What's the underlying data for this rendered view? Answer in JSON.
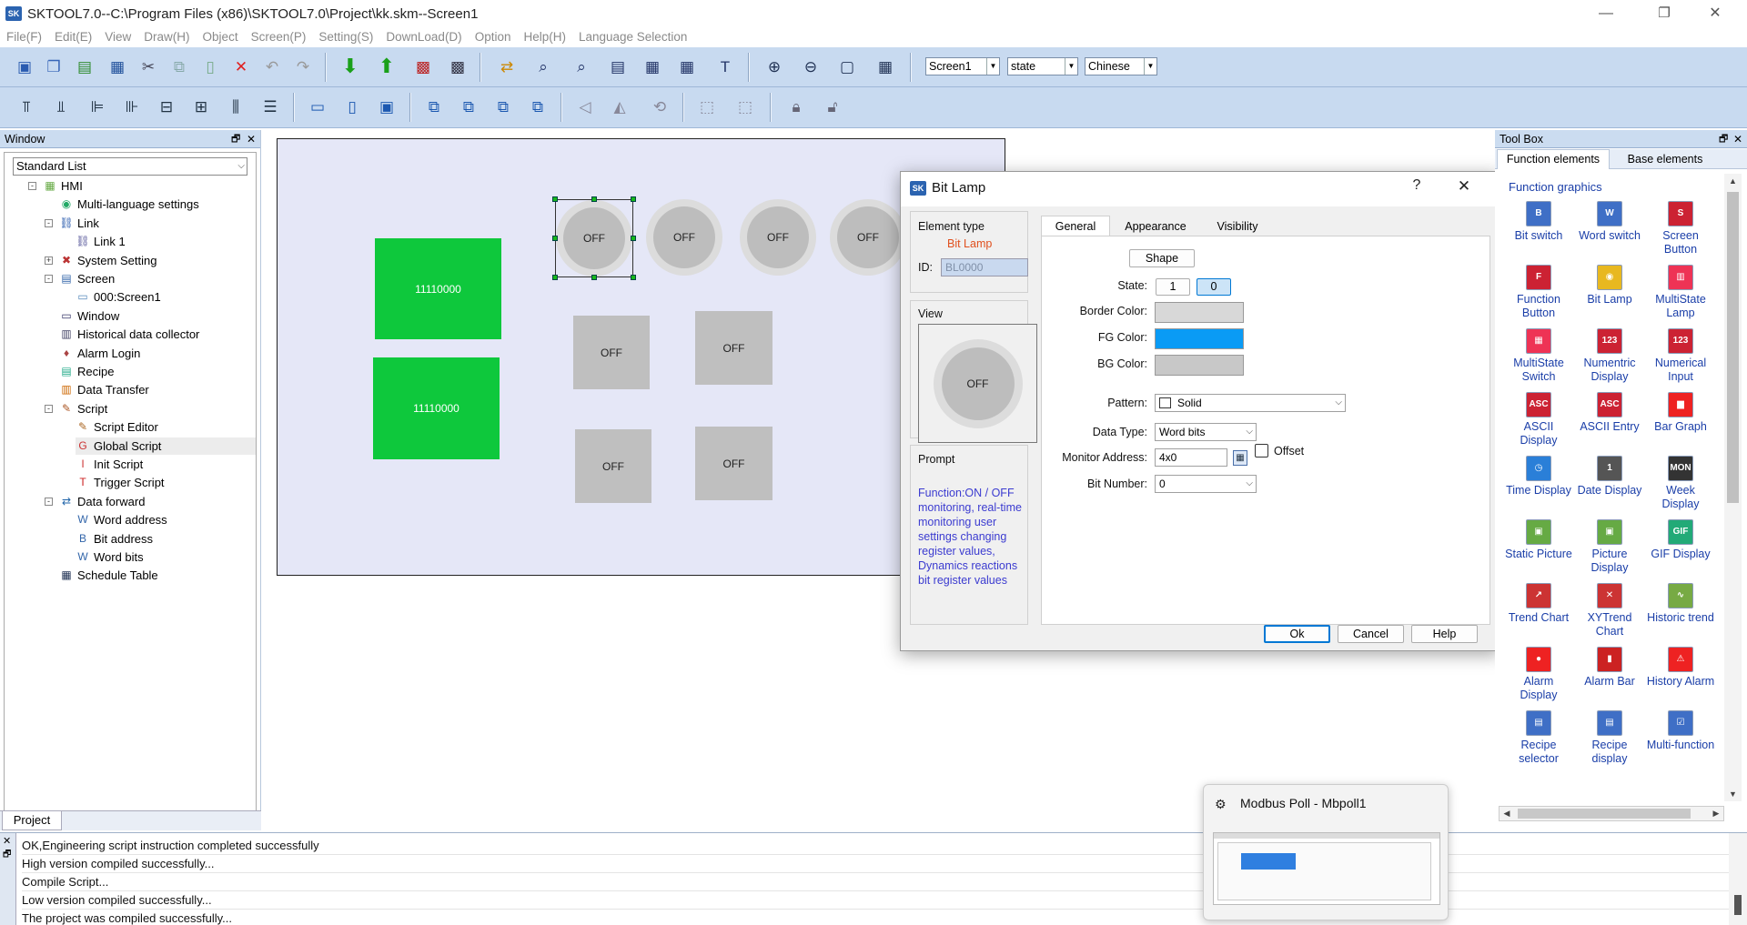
{
  "app": {
    "title": "SKTOOL7.0--C:\\Program Files (x86)\\SKTOOL7.0\\Project\\kk.skm--Screen1",
    "icon_text": "SK"
  },
  "menu": [
    "File(F)",
    "Edit(E)",
    "View",
    "Draw(H)",
    "Object",
    "Screen(P)",
    "Setting(S)",
    "DownLoad(D)",
    "Option",
    "Help(H)",
    "Language Selection"
  ],
  "toolbar": {
    "screen_select": "Screen1",
    "state_select": "state",
    "language_select": "Chinese"
  },
  "window_panel": {
    "title": "Window",
    "list_select": "Standard List",
    "tree": [
      {
        "label": "HMI",
        "icon": "hmi-icon",
        "level": 0,
        "exp": "-"
      },
      {
        "label": "Multi-language settings",
        "icon": "globe-icon",
        "level": 1
      },
      {
        "label": "Link",
        "icon": "link-icon",
        "level": 1,
        "exp": "-"
      },
      {
        "label": "Link 1",
        "icon": "link-item-icon",
        "level": 2
      },
      {
        "label": "System Setting",
        "icon": "tools-icon",
        "level": 1,
        "exp": "+"
      },
      {
        "label": "Screen",
        "icon": "screen-icon",
        "level": 1,
        "exp": "-"
      },
      {
        "label": "000:Screen1",
        "icon": "screen-page-icon",
        "level": 2
      },
      {
        "label": "Window",
        "icon": "window-icon",
        "level": 1
      },
      {
        "label": "Historical data collector",
        "icon": "history-icon",
        "level": 1
      },
      {
        "label": "Alarm Login",
        "icon": "alarm-icon",
        "level": 1
      },
      {
        "label": "Recipe",
        "icon": "recipe-icon",
        "level": 1
      },
      {
        "label": "Data Transfer",
        "icon": "transfer-icon",
        "level": 1
      },
      {
        "label": "Script",
        "icon": "script-icon",
        "level": 1,
        "exp": "-"
      },
      {
        "label": "Script Editor",
        "icon": "pen-icon",
        "level": 2
      },
      {
        "label": "Global Script",
        "icon": "global-script-icon",
        "level": 2
      },
      {
        "label": "Init Script",
        "icon": "init-script-icon",
        "level": 2
      },
      {
        "label": "Trigger Script",
        "icon": "trigger-script-icon",
        "level": 2
      },
      {
        "label": "Data forward",
        "icon": "forward-icon",
        "level": 1,
        "exp": "-"
      },
      {
        "label": "Word address",
        "icon": "word-icon",
        "level": 2
      },
      {
        "label": "Bit address",
        "icon": "bit-icon",
        "level": 2
      },
      {
        "label": "Word bits",
        "icon": "wordbits-icon",
        "level": 2
      },
      {
        "label": "Schedule Table",
        "icon": "calendar-icon",
        "level": 1
      }
    ],
    "bottom_tab": "Project"
  },
  "canvas": {
    "green_boxes": [
      "11110000",
      "11110000"
    ],
    "lamps": [
      "OFF",
      "OFF",
      "OFF",
      "OFF"
    ],
    "squares": [
      "OFF",
      "OFF",
      "OFF",
      "OFF"
    ]
  },
  "dialog": {
    "title": "Bit Lamp",
    "help_glyph": "?",
    "close_glyph": "✕",
    "element_type_label": "Element type",
    "element_type_value": "Bit Lamp",
    "id_label": "ID:",
    "id_value": "BL0000",
    "view_label": "View",
    "view_text": "OFF",
    "prompt_label": "Prompt",
    "prompt_text": "Function:ON / OFF monitoring, real-time monitoring user settings changing register values, Dynamics reactions bit register values",
    "tabs": [
      "General",
      "Appearance",
      "Visibility"
    ],
    "shape_button": "Shape",
    "state_label": "State:",
    "state_1": "1",
    "state_0": "0",
    "border_color_label": "Border Color:",
    "fg_color_label": "FG Color:",
    "bg_color_label": "BG Color:",
    "pattern_label": "Pattern:",
    "pattern_value": "Solid",
    "data_type_label": "Data Type:",
    "data_type_value": "Word bits",
    "monitor_address_label": "Monitor Address:",
    "monitor_address_value": "4x0",
    "offset_label": "Offset",
    "bit_number_label": "Bit Number:",
    "bit_number_value": "0",
    "ok_button": "Ok",
    "cancel_button": "Cancel",
    "help_button": "Help",
    "colors": {
      "border": "#d8d8d8",
      "fg": "#0a9bf5",
      "bg": "#c8c8c8"
    }
  },
  "toolbox": {
    "title": "Tool Box",
    "tabs": [
      "Function elements",
      "Base elements"
    ],
    "section": "Function graphics",
    "items": [
      {
        "label": "Bit switch",
        "icon": "bit-switch-icon",
        "glyph": "B"
      },
      {
        "label": "Word switch",
        "icon": "word-switch-icon",
        "glyph": "W"
      },
      {
        "label": "Screen Button",
        "icon": "screen-button-icon",
        "glyph": "S"
      },
      {
        "label": "Function Button",
        "icon": "function-button-icon",
        "glyph": "F"
      },
      {
        "label": "Bit Lamp",
        "icon": "bit-lamp-icon",
        "glyph": "◉"
      },
      {
        "label": "MultiState Lamp",
        "icon": "multistate-lamp-icon",
        "glyph": "▥"
      },
      {
        "label": "MultiState Switch",
        "icon": "multistate-switch-icon",
        "glyph": "▦"
      },
      {
        "label": "Numentric Display",
        "icon": "numeric-display-icon",
        "glyph": "123"
      },
      {
        "label": "Numerical Input",
        "icon": "numeric-input-icon",
        "glyph": "123"
      },
      {
        "label": "ASCII Display",
        "icon": "ascii-display-icon",
        "glyph": "ASC"
      },
      {
        "label": "ASCII Entry",
        "icon": "ascii-entry-icon",
        "glyph": "ASC"
      },
      {
        "label": "Bar Graph",
        "icon": "bar-graph-icon",
        "glyph": "▆"
      },
      {
        "label": "Time Display",
        "icon": "clock-icon",
        "glyph": "◷"
      },
      {
        "label": "Date Display",
        "icon": "date-icon",
        "glyph": "1"
      },
      {
        "label": "Week Display",
        "icon": "week-icon",
        "glyph": "MON"
      },
      {
        "label": "Static Picture",
        "icon": "static-picture-icon",
        "glyph": "▣"
      },
      {
        "label": "Picture Display",
        "icon": "picture-display-icon",
        "glyph": "▣"
      },
      {
        "label": "GIF Display",
        "icon": "gif-icon",
        "glyph": "GIF"
      },
      {
        "label": "Trend Chart",
        "icon": "trend-chart-icon",
        "glyph": "↗"
      },
      {
        "label": "XYTrend Chart",
        "icon": "xytrend-chart-icon",
        "glyph": "✕"
      },
      {
        "label": "Historic trend",
        "icon": "historic-trend-icon",
        "glyph": "∿"
      },
      {
        "label": "Alarm Display",
        "icon": "alarm-light-icon",
        "glyph": "●"
      },
      {
        "label": "Alarm Bar",
        "icon": "alarm-bar-icon",
        "glyph": "▮"
      },
      {
        "label": "History Alarm",
        "icon": "history-alarm-icon",
        "glyph": "⚠"
      },
      {
        "label": "Recipe selector",
        "icon": "recipe-selector-icon",
        "glyph": "▤"
      },
      {
        "label": "Recipe display",
        "icon": "recipe-display-icon",
        "glyph": "▤"
      },
      {
        "label": "Multi-function",
        "icon": "multi-function-icon",
        "glyph": "☑"
      }
    ]
  },
  "output": [
    "OK,Engineering script instruction completed successfully",
    "High version compiled successfully...",
    "Compile Script...",
    "Low version compiled successfully...",
    "The project was compiled successfully..."
  ],
  "taskbar_preview": {
    "title": "Modbus Poll - Mbpoll1"
  }
}
